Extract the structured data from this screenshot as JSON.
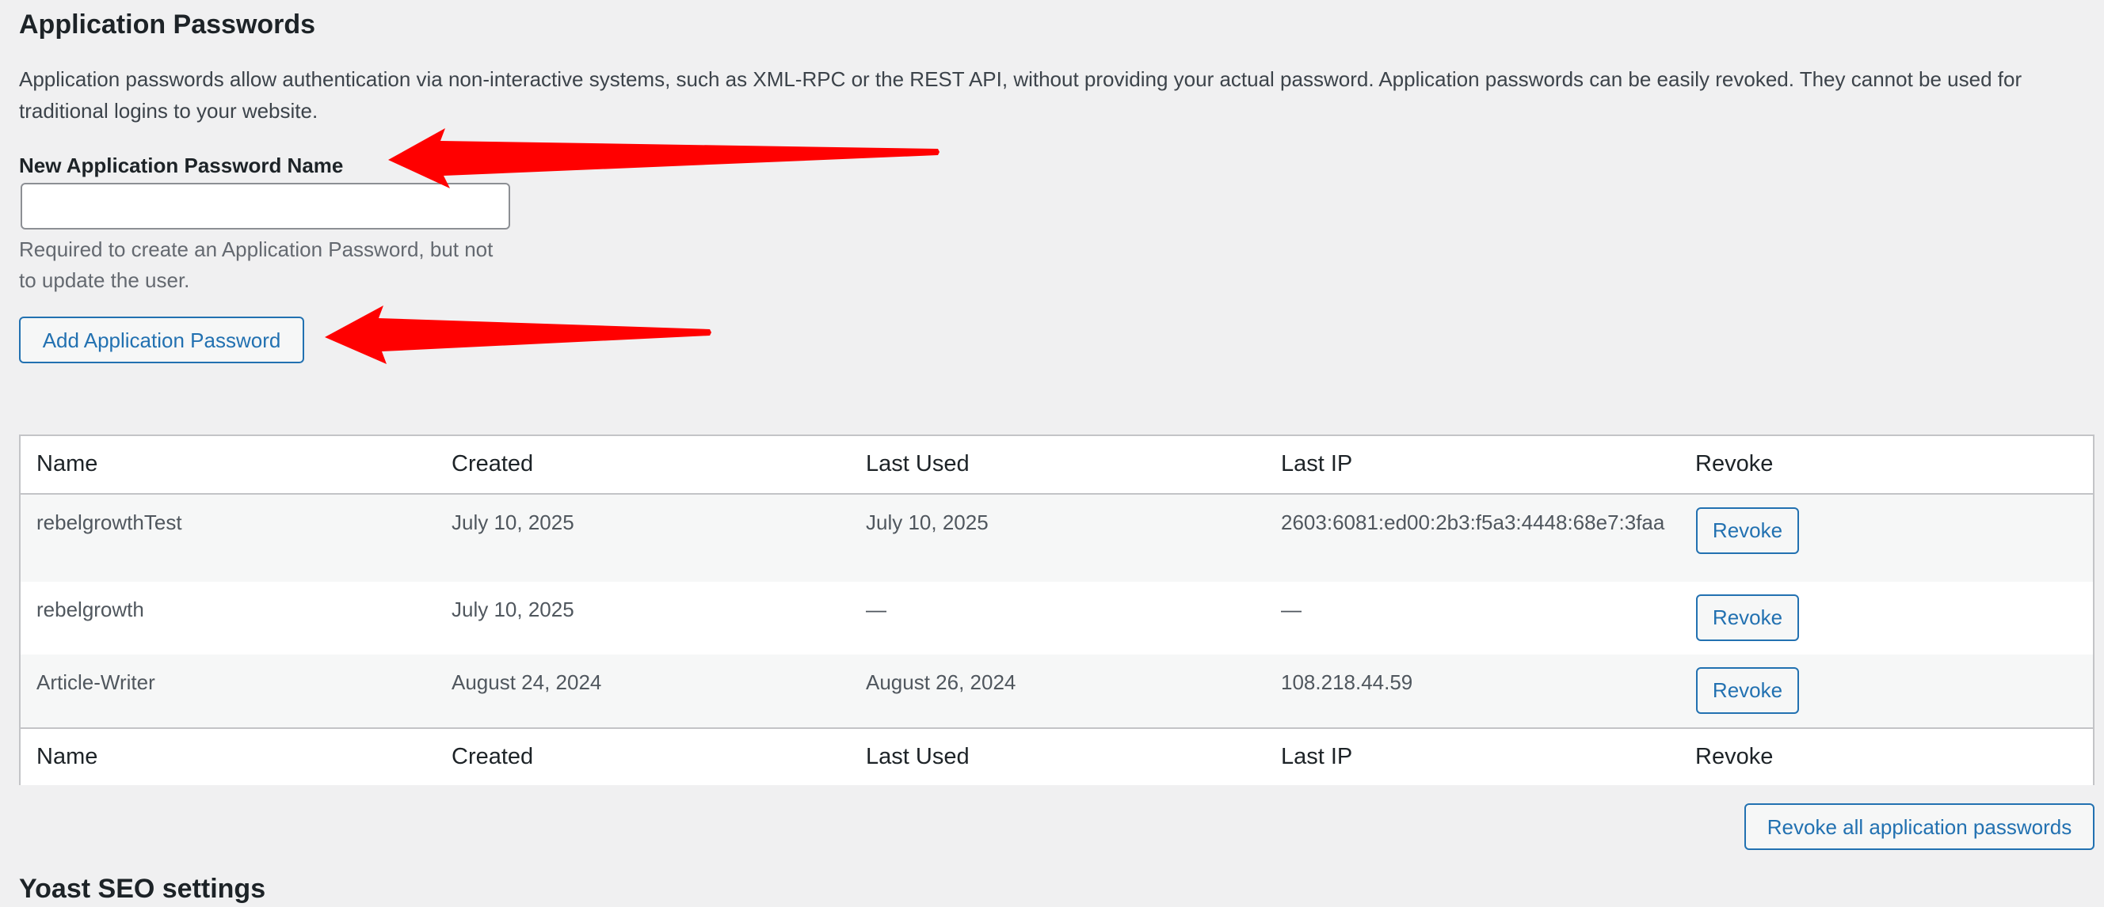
{
  "section": {
    "title": "Application Passwords",
    "description": "Application passwords allow authentication via non-interactive systems, such as XML-RPC or the REST API, without providing your actual password. Application passwords can be easily revoked. They cannot be used for traditional logins to your website."
  },
  "new_password": {
    "label": "New Application Password Name",
    "value": "",
    "placeholder": "",
    "help": "Required to create an Application Password, but not to update the user.",
    "add_button_label": "Add Application Password"
  },
  "table": {
    "columns": [
      "Name",
      "Created",
      "Last Used",
      "Last IP",
      "Revoke"
    ],
    "rows": [
      {
        "name": "rebelgrowthTest",
        "created": "July 10, 2025",
        "last_used": "July 10, 2025",
        "last_ip": "2603:6081:ed00:2b3:f5a3:4448:68e7:3faa",
        "revoke_label": "Revoke"
      },
      {
        "name": "rebelgrowth",
        "created": "July 10, 2025",
        "last_used": "—",
        "last_ip": "—",
        "revoke_label": "Revoke"
      },
      {
        "name": "Article-Writer",
        "created": "August 24, 2024",
        "last_used": "August 26, 2024",
        "last_ip": "108.218.44.59",
        "revoke_label": "Revoke"
      }
    ]
  },
  "revoke_all_label": "Revoke all application passwords",
  "next_section_title": "Yoast SEO settings",
  "colors": {
    "accent": "#2271b1",
    "annotation_arrow": "#ff0000",
    "background": "#f0f0f1"
  }
}
